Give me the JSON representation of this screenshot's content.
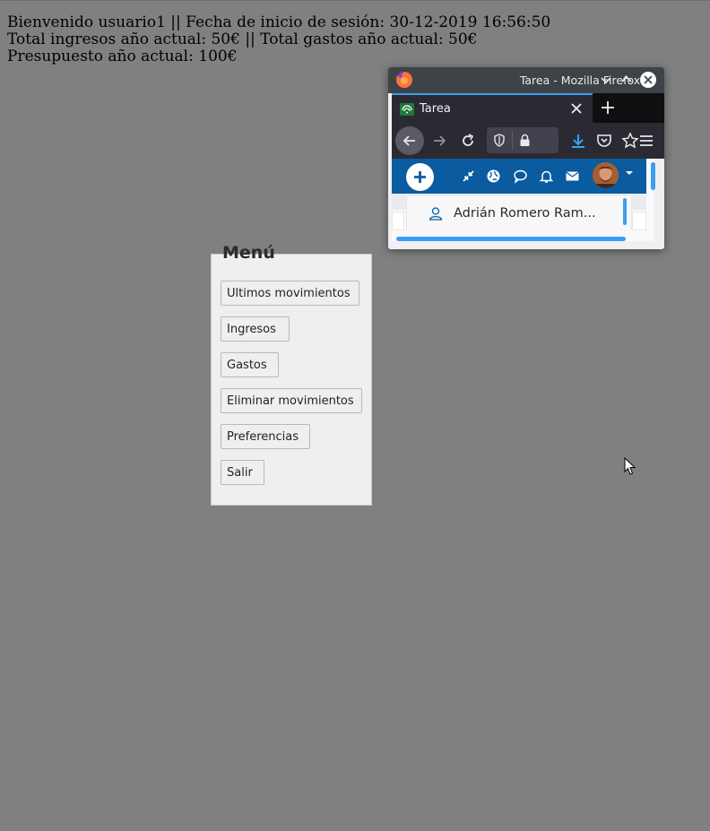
{
  "header": {
    "line1": "Bienvenido usuario1 || Fecha de inicio de sesión: 30-12-2019 16:56:50",
    "line2": "Total ingresos año actual: 50€ || Total gastos año actual: 50€",
    "line3": "Presupuesto año actual: 100€"
  },
  "menu": {
    "title": "Menú",
    "items": [
      {
        "label": "Ultimos movimientos"
      },
      {
        "label": "Ingresos"
      },
      {
        "label": "Gastos"
      },
      {
        "label": "Eliminar movimientos"
      },
      {
        "label": "Preferencias"
      },
      {
        "label": "Salir"
      }
    ]
  },
  "firefox": {
    "window_title": "Tarea - Mozilla Firefox",
    "tab_title": "Tarea",
    "user_name": "Adrián Romero Ram...",
    "icons": [
      "firefox-logo-icon",
      "minimize-icon",
      "maximize-icon",
      "close-icon",
      "back-icon",
      "forward-icon",
      "reload-icon",
      "shield-icon",
      "lock-icon",
      "download-icon",
      "pocket-icon",
      "bookmark-star-icon",
      "hamburger-menu-icon",
      "plus-icon",
      "compress-icon",
      "globe-icon",
      "chat-icon",
      "bell-icon",
      "mail-icon",
      "user-icon"
    ],
    "colors": {
      "accent": "#0a5ba0",
      "highlight": "#3aa0f0"
    }
  },
  "colors": {
    "desktop": "#808080",
    "panel": "#efefef"
  }
}
